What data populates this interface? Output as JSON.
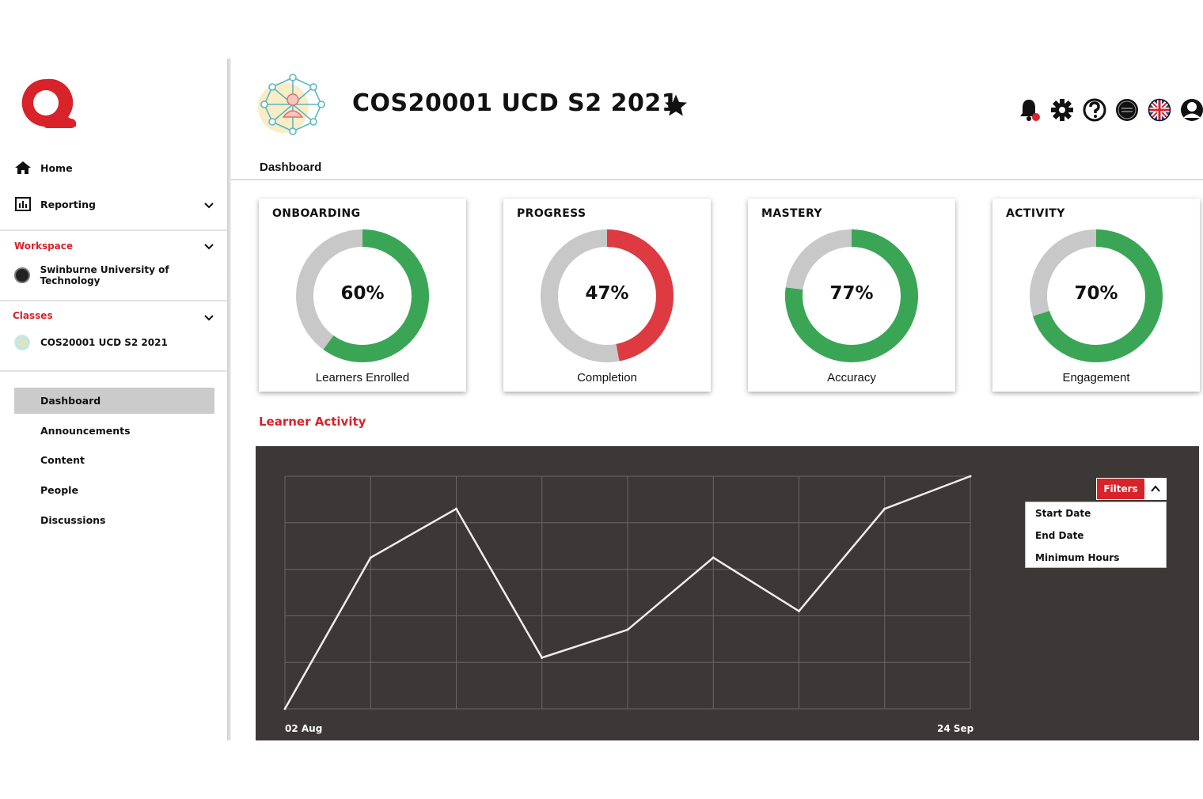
{
  "sidebar": {
    "home": "Home",
    "reporting": "Reporting",
    "workspace_label": "Workspace",
    "workspace_name": "Swinburne University of Technology",
    "classes_label": "Classes",
    "class_name": "COS20001 UCD S2 2021",
    "menu": [
      "Dashboard",
      "Announcements",
      "Content",
      "People",
      "Discussions"
    ],
    "active_menu": "Dashboard"
  },
  "header": {
    "title": "COS20001 UCD S2 2021",
    "breadcrumb": "Dashboard",
    "icons": [
      "notification-bell-icon",
      "settings-gear-icon",
      "help-icon",
      "institution-avatar",
      "language-uk-flag-icon",
      "user-account-icon"
    ]
  },
  "cards": [
    {
      "title": "ONBOARDING",
      "percent": "60%",
      "value": 60,
      "label": "Learners Enrolled",
      "color": "#3aa655"
    },
    {
      "title": "PROGRESS",
      "percent": "47%",
      "value": 47,
      "label": "Completion",
      "color": "#de3a41"
    },
    {
      "title": "MASTERY",
      "percent": "77%",
      "value": 77,
      "label": "Accuracy",
      "color": "#3aa655"
    },
    {
      "title": "ACTIVITY",
      "percent": "70%",
      "value": 70,
      "label": "Engagement",
      "color": "#3aa655"
    }
  ],
  "activity": {
    "heading": "Learner Activity",
    "filters_label": "Filters",
    "filter_options": [
      "Start Date",
      "End Date",
      "Minimum Hours"
    ]
  },
  "chart_data": {
    "type": "line",
    "x_start_label": "02 Aug",
    "x_end_label": "24 Sep",
    "x": [
      0,
      1,
      2,
      3,
      4,
      5,
      6,
      7,
      8
    ],
    "values": [
      0,
      65,
      86,
      22,
      34,
      65,
      42,
      86,
      100
    ],
    "ylim": [
      0,
      100
    ],
    "grid": true,
    "line_color": "#eeeeee",
    "background": "#3c3838"
  },
  "colors": {
    "accent": "#d8232a",
    "green": "#3aa655",
    "track": "#c8c8c8"
  }
}
